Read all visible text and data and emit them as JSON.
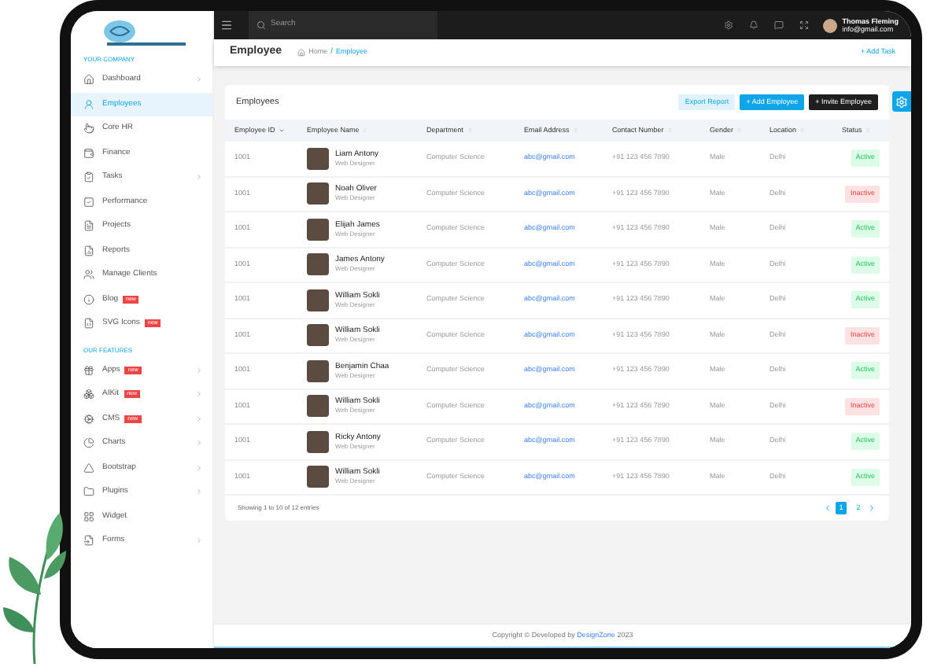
{
  "sidebar": {
    "sections": [
      {
        "heading": "YOUR COMPANY",
        "items": [
          {
            "label": "Dashboard",
            "arrow": true,
            "selected": false
          },
          {
            "label": "Employees",
            "arrow": false,
            "selected": true
          },
          {
            "label": "Core HR",
            "arrow": false,
            "selected": false
          },
          {
            "label": "Finance",
            "arrow": false,
            "selected": false
          },
          {
            "label": "Tasks",
            "arrow": true,
            "selected": false
          },
          {
            "label": "Performance",
            "arrow": false,
            "selected": false
          },
          {
            "label": "Projects",
            "arrow": false,
            "selected": false
          },
          {
            "label": "Reports",
            "arrow": false,
            "selected": false
          },
          {
            "label": "Manage Clients",
            "arrow": false,
            "selected": false
          },
          {
            "label": "Blog",
            "badge": "new",
            "arrow": false,
            "selected": false
          },
          {
            "label": "SVG Icons",
            "badge": "new",
            "arrow": false,
            "selected": false
          }
        ]
      },
      {
        "heading": "OUR FEATURES",
        "items": [
          {
            "label": "Apps",
            "badge": "new",
            "arrow": true,
            "selected": false
          },
          {
            "label": "AIKit",
            "badge": "new",
            "arrow": true,
            "selected": false
          },
          {
            "label": "CMS",
            "badge": "new",
            "arrow": true,
            "selected": false
          },
          {
            "label": "Charts",
            "arrow": true,
            "selected": false
          },
          {
            "label": "Bootstrap",
            "arrow": true,
            "selected": false
          },
          {
            "label": "Plugins",
            "arrow": true,
            "selected": false
          },
          {
            "label": "Widget",
            "arrow": false,
            "selected": false
          },
          {
            "label": "Forms",
            "arrow": true,
            "selected": false
          }
        ]
      }
    ]
  },
  "topbar": {
    "search": {
      "placeholder": "Search"
    },
    "user": {
      "name": "Thomas Fleming",
      "email": "info@gmail.com"
    }
  },
  "page_header": {
    "title": "Employee",
    "breadcrumbs": [
      "Home",
      "Employee"
    ],
    "breadcrumb_separator": "/",
    "action": "+ Add Task"
  },
  "card": {
    "title": "Employees",
    "buttons": [
      {
        "label": "Export Report",
        "kind": "light"
      },
      {
        "label": "+ Add Employee",
        "kind": "primary"
      },
      {
        "label": "+ Invite Employee",
        "kind": "dark"
      }
    ],
    "columns": [
      {
        "label": "Employee ID",
        "sorted": true
      },
      {
        "label": "Employee Name",
        "sorted": false
      },
      {
        "label": "Department",
        "sorted": false
      },
      {
        "label": "Email Address",
        "sorted": false
      },
      {
        "label": "Contact Number",
        "sorted": false
      },
      {
        "label": "Gender",
        "sorted": false
      },
      {
        "label": "Location",
        "sorted": false
      },
      {
        "label": "Status",
        "sorted": false
      }
    ],
    "rows": [
      {
        "id": "1001",
        "name": "Liam Antony",
        "role": "Web Designer",
        "department": "Computer Science",
        "email": "abc@gmail.com",
        "phone": "+91 123 456 7890",
        "gender": "Male",
        "location": "Delhi",
        "status": {
          "label": "Active",
          "kind": "active"
        }
      },
      {
        "id": "1001",
        "name": "Noah Oliver",
        "role": "Web Designer",
        "department": "Computer Science",
        "email": "abc@gmail.com",
        "phone": "+91 123 456 7890",
        "gender": "Male",
        "location": "Delhi",
        "status": {
          "label": "Inactive",
          "kind": "inactive"
        }
      },
      {
        "id": "1001",
        "name": "Elijah James",
        "role": "Web Designer",
        "department": "Computer Science",
        "email": "abc@gmail.com",
        "phone": "+91 123 456 7890",
        "gender": "Male",
        "location": "Delhi",
        "status": {
          "label": "Active",
          "kind": "active"
        }
      },
      {
        "id": "1001",
        "name": "James Antony",
        "role": "Web Designer",
        "department": "Computer Science",
        "email": "abc@gmail.com",
        "phone": "+91 123 456 7890",
        "gender": "Male",
        "location": "Delhi",
        "status": {
          "label": "Active",
          "kind": "active"
        }
      },
      {
        "id": "1001",
        "name": "William Sokli",
        "role": "Web Designer",
        "department": "Computer Science",
        "email": "abc@gmail.com",
        "phone": "+91 123 456 7890",
        "gender": "Male",
        "location": "Delhi",
        "status": {
          "label": "Active",
          "kind": "active"
        }
      },
      {
        "id": "1001",
        "name": "William Sokli",
        "role": "Web Designer",
        "department": "Computer Science",
        "email": "abc@gmail.com",
        "phone": "+91 123 456 7890",
        "gender": "Male",
        "location": "Delhi",
        "status": {
          "label": "Inactive",
          "kind": "inactive"
        }
      },
      {
        "id": "1001",
        "name": "Benjamin Chaa",
        "role": "Web Designer",
        "department": "Computer Science",
        "email": "abc@gmail.com",
        "phone": "+91 123 456 7890",
        "gender": "Male",
        "location": "Delhi",
        "status": {
          "label": "Active",
          "kind": "active"
        }
      },
      {
        "id": "1001",
        "name": "William Sokli",
        "role": "Web Designer",
        "department": "Computer Science",
        "email": "abc@gmail.com",
        "phone": "+91 123 456 7890",
        "gender": "Male",
        "location": "Delhi",
        "status": {
          "label": "Inactive",
          "kind": "inactive"
        }
      },
      {
        "id": "1001",
        "name": "Ricky Antony",
        "role": "Web Designer",
        "department": "Computer Science",
        "email": "abc@gmail.com",
        "phone": "+91 123 456 7890",
        "gender": "Male",
        "location": "Delhi",
        "status": {
          "label": "Active",
          "kind": "active"
        }
      },
      {
        "id": "1001",
        "name": "William Sokli",
        "role": "Web Designer",
        "department": "Computer Science",
        "email": "abc@gmail.com",
        "phone": "+91 123 456 7890",
        "gender": "Male",
        "location": "Delhi",
        "status": {
          "label": "Active",
          "kind": "active"
        }
      }
    ],
    "summary": "Showing 1 to 10 of 12 entries",
    "pages": [
      {
        "label": "1",
        "selected": true
      },
      {
        "label": "2",
        "selected": false
      }
    ]
  },
  "footer": {
    "text": "Copyright © Developed by",
    "link": "DesignZone",
    "year": "2023"
  }
}
